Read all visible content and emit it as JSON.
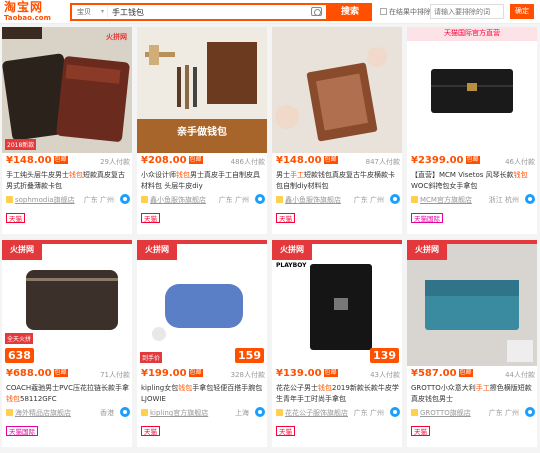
{
  "header": {
    "logo_main": "淘宝网",
    "logo_sub": "Taobao.com",
    "scope": "宝贝",
    "search_value": "手工钱包",
    "search_button": "搜索",
    "in_results": "在结果中排除",
    "exclude_placeholder": "请输入要排除的词",
    "confirm": "确定"
  },
  "products": [
    {
      "price": "¥148.00",
      "tag": "包邮",
      "sales": "29人付款",
      "title_a": "手工纯头层牛皮男士",
      "title_hl": "钱包",
      "title_b": "短款真皮复古男式折叠薄款卡包",
      "shop": "sophmodia旗舰店",
      "loc": "广东 广州",
      "badge": "天猫",
      "img_hot": "火拼网",
      "img_label": "2018新款"
    },
    {
      "price": "¥208.00",
      "tag": "包邮",
      "sales": "486人付款",
      "title_a": "小众设计师",
      "title_hl": "钱包",
      "title_b": "男士真皮手工自制皮具材料包 头层牛皮diy",
      "shop": "鑫小鱼服饰旗舰店",
      "loc": "广东 广州",
      "badge": "天猫",
      "img_overlay": "亲手做钱包"
    },
    {
      "price": "¥148.00",
      "tag": "包邮",
      "sales": "847人付款",
      "title_a": "男士",
      "title_hl": "手工",
      "title_b": "短款钱包真皮复古牛皮横款卡包自制diy材料包",
      "shop": "鑫小鱼服饰旗舰店",
      "loc": "广东 广州",
      "badge": "天猫"
    },
    {
      "price": "¥2399.00",
      "tag": "包邮",
      "sales": "46人付款",
      "title_a": "【直营】MCM Visetos 风琴长款",
      "title_hl": "钱包",
      "title_b": " WOC斜挎包女手拿包",
      "shop": "MCM官方旗舰店",
      "loc": "浙江 杭州",
      "badge": "天猫国际",
      "img_top": "天猫国际官方直营"
    },
    {
      "price": "¥688.00",
      "tag": "包邮",
      "sales": "71人付款",
      "title_a": "COACH蔻驰男士PVC压花拉链长款手拿",
      "title_hl": "钱包",
      "title_b": "58112GFC",
      "shop": "海外精品店旗舰店",
      "loc": "香港",
      "badge": "天猫国际",
      "img_hot": "火拼网",
      "img_label": "全天火拼",
      "img_price": "638"
    },
    {
      "price": "¥199.00",
      "tag": "包邮",
      "sales": "328人付款",
      "title_a": "kipling女包",
      "title_hl": "钱包",
      "title_b": "手拿包轻便百搭手腕包 LJOWIE",
      "shop": "kipling官方旗舰店",
      "loc": "上海",
      "badge": "天猫",
      "img_hot": "火拼网",
      "img_label": "到手价",
      "img_price": "159"
    },
    {
      "price": "¥139.00",
      "tag": "包邮",
      "sales": "43人付款",
      "title_a": "花花公子男士",
      "title_hl": "钱包",
      "title_b": "2019新款长款牛皮学生青年手工时尚手拿包",
      "shop": "花花公子服饰旗舰店",
      "loc": "广东 广州",
      "badge": "天猫",
      "img_hot": "火拼网",
      "img_label": "PLAYBOY",
      "img_price": "139"
    },
    {
      "price": "¥587.00",
      "tag": "包邮",
      "sales": "44人付款",
      "title_a": "GROTTO小众意大利",
      "title_hl": "手工",
      "title_b": "擦色横版短款真皮钱包男士",
      "shop": "GROTTO旗舰店",
      "loc": "广东 广州",
      "badge": "天猫",
      "img_hot": "火拼网"
    }
  ],
  "colors": {
    "accent": "#ff5000",
    "tmall": "#ff0036"
  }
}
